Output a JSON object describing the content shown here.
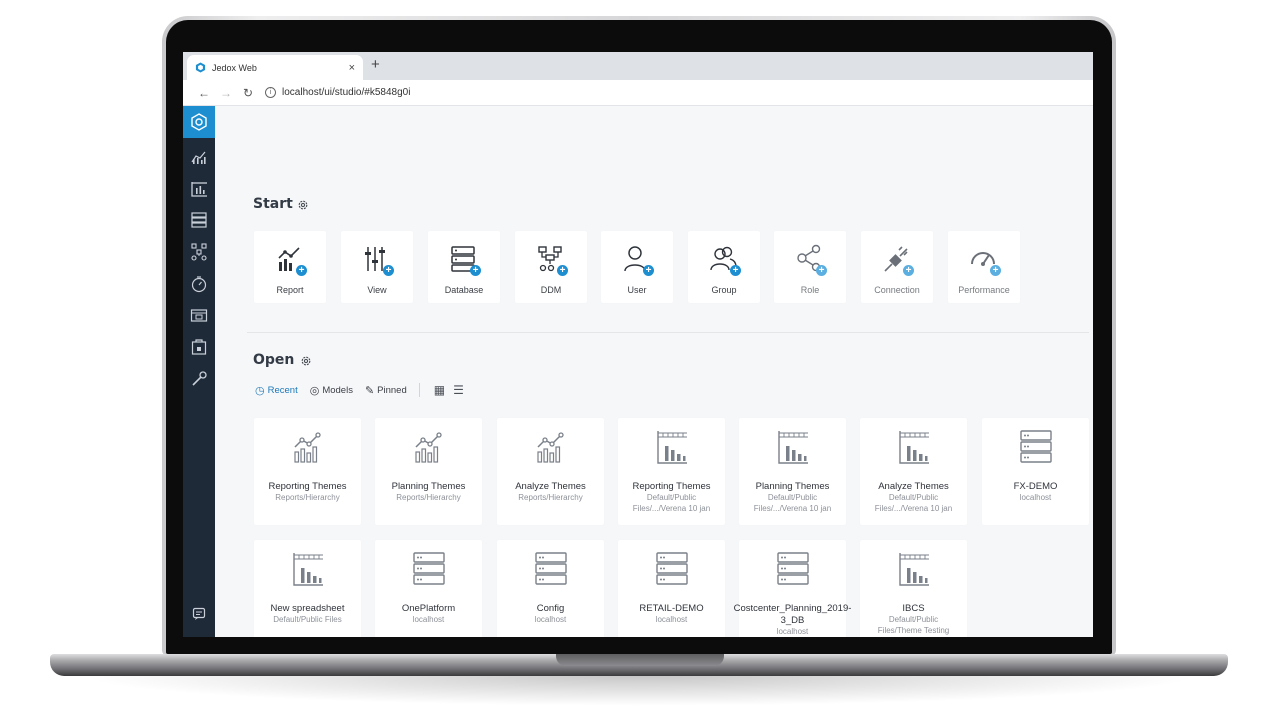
{
  "browser": {
    "tab_title": "Jedox Web",
    "close_glyph": "×",
    "new_tab_glyph": "+",
    "url": "localhost/ui/studio/#k5848g0i",
    "back_glyph": "←",
    "forward_glyph": "→",
    "reload_glyph": "↻",
    "info_glyph": "i"
  },
  "sidebar": {
    "items": [
      "home-icon",
      "reports-icon",
      "spreadsheet-icon",
      "database-icon",
      "ddm-icon",
      "scheduler-icon",
      "connections-icon",
      "marketplace-icon",
      "tools-icon",
      "chat-icon"
    ]
  },
  "start": {
    "title": "Start",
    "cards": [
      {
        "label": "Report",
        "icon": "report-icon"
      },
      {
        "label": "View",
        "icon": "view-icon"
      },
      {
        "label": "Database",
        "icon": "database-icon"
      },
      {
        "label": "DDM",
        "icon": "ddm-icon"
      },
      {
        "label": "User",
        "icon": "user-icon"
      },
      {
        "label": "Group",
        "icon": "group-icon"
      },
      {
        "label": "Role",
        "icon": "role-icon"
      },
      {
        "label": "Connection",
        "icon": "connection-icon"
      },
      {
        "label": "Performance",
        "icon": "performance-icon"
      }
    ]
  },
  "open": {
    "title": "Open",
    "filters": {
      "recent": "Recent",
      "models": "Models",
      "pinned": "Pinned"
    },
    "items": [
      {
        "name": "Reporting Themes",
        "sub": "Reports/Hierarchy",
        "type": "report"
      },
      {
        "name": "Planning Themes",
        "sub": "Reports/Hierarchy",
        "type": "report"
      },
      {
        "name": "Analyze Themes",
        "sub": "Reports/Hierarchy",
        "type": "report"
      },
      {
        "name": "Reporting Themes",
        "sub": "Default/Public Files/.../Verena 10 jan",
        "type": "spreadsheet"
      },
      {
        "name": "Planning Themes",
        "sub": "Default/Public Files/.../Verena 10 jan",
        "type": "spreadsheet"
      },
      {
        "name": "Analyze Themes",
        "sub": "Default/Public Files/.../Verena 10 jan",
        "type": "spreadsheet"
      },
      {
        "name": "FX-DEMO",
        "sub": "localhost",
        "type": "database"
      },
      {
        "name": "New spreadsheet",
        "sub": "Default/Public Files",
        "type": "spreadsheet"
      },
      {
        "name": "OnePlatform",
        "sub": "localhost",
        "type": "database"
      },
      {
        "name": "Config",
        "sub": "localhost",
        "type": "database"
      },
      {
        "name": "RETAIL-DEMO",
        "sub": "localhost",
        "type": "database"
      },
      {
        "name": "Costcenter_Planning_2019-3_DB",
        "sub": "localhost",
        "type": "database"
      },
      {
        "name": "IBCS",
        "sub": "Default/Public Files/Theme Testing",
        "type": "spreadsheet"
      }
    ]
  },
  "colors": {
    "accent": "#1d8fd1",
    "sidebar": "#1f2a38",
    "background": "#f6f7f9"
  }
}
